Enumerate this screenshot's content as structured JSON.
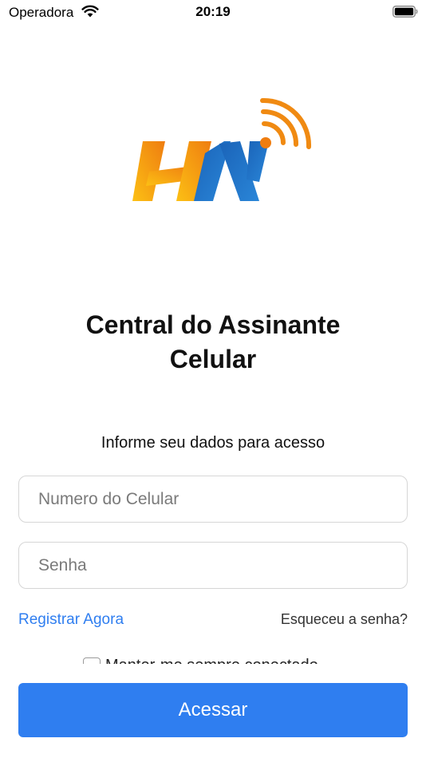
{
  "status_bar": {
    "carrier": "Operadora",
    "time": "20:19",
    "icons": [
      "wifi-icon",
      "battery-icon"
    ]
  },
  "logo": {
    "icon": "brand-logo",
    "colors": {
      "orange": "#f08a12",
      "yellow": "#fbb714",
      "blue": "#1f6fc4"
    }
  },
  "header": {
    "title": "Central do Assinante Celular",
    "subtitle": "Informe seu dados para acesso"
  },
  "form": {
    "phone_placeholder": "Numero do Celular",
    "phone_value": "",
    "password_placeholder": "Senha",
    "password_value": "",
    "register_label": "Registrar Agora",
    "forgot_label": "Esqueceu a senha?",
    "remember_label": "Manter-me sempre conectado",
    "submit_label": "Acessar"
  },
  "colors": {
    "accent": "#2f7ef0",
    "border": "#d6d6d6",
    "text": "#111111"
  }
}
